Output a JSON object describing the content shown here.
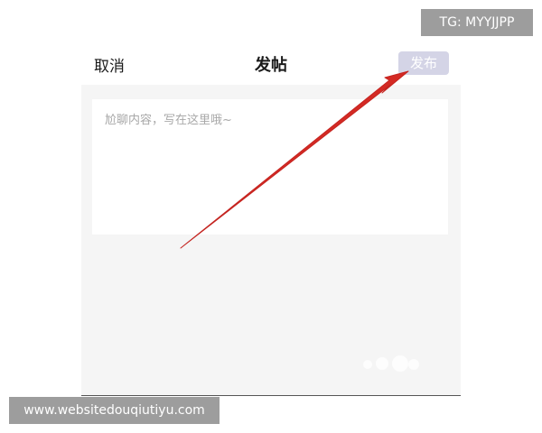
{
  "header": {
    "cancel_label": "取消",
    "title": "发帖",
    "publish_label": "发布"
  },
  "editor": {
    "placeholder": "尬聊内容，写在这里哦~"
  },
  "overlays": {
    "tg_text": "TG: MYYJJPP",
    "site_text": "www.websitedouqiutiyu.com"
  },
  "colors": {
    "publish_button_bg": "#d4d4e6",
    "content_bg": "#f5f5f5",
    "arrow_color": "#d42a24",
    "watermark_bg": "#9d9d9d"
  }
}
